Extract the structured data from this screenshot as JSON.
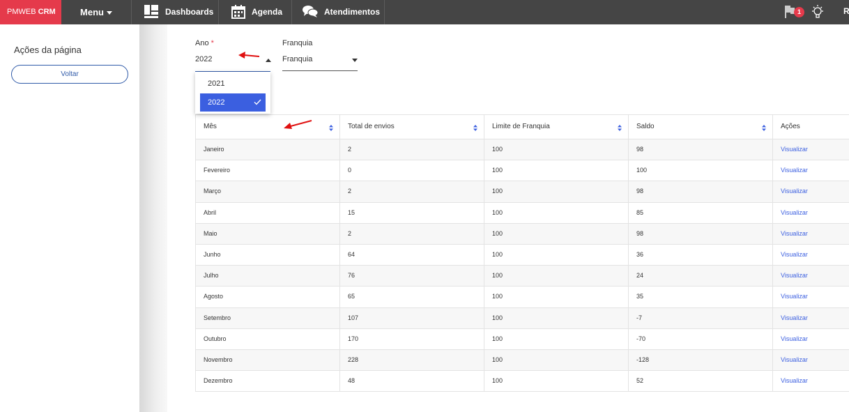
{
  "topbar": {
    "brand_light": "PMWEB ",
    "brand_bold": "CRM",
    "menu_label": "Menu",
    "nav": [
      {
        "label": "Dashboards",
        "icon": "dashboard-icon"
      },
      {
        "label": "Agenda",
        "icon": "calendar-icon"
      },
      {
        "label": "Atendimentos",
        "icon": "chat-icon"
      }
    ],
    "notifications_count": "1",
    "user_initial": "R",
    "brand_color": "#e53a4b",
    "bar_color": "#454545"
  },
  "sidebar": {
    "title": "Ações da página",
    "back_label": "Voltar"
  },
  "filters": {
    "ano_label": "Ano",
    "ano_required": "*",
    "ano_value": "2022",
    "ano_options": [
      "2021",
      "2022"
    ],
    "ano_selected": "2022",
    "franquia_label": "Franquia",
    "franquia_value": "Franquia"
  },
  "table": {
    "headers": [
      "Mês",
      "Total de envios",
      "Limite de Franquia",
      "Saldo",
      "Ações"
    ],
    "rows": [
      [
        "Janeiro",
        "2",
        "100",
        "98",
        "Visualizar"
      ],
      [
        "Fevereiro",
        "0",
        "100",
        "100",
        "Visualizar"
      ],
      [
        "Março",
        "2",
        "100",
        "98",
        "Visualizar"
      ],
      [
        "Abril",
        "15",
        "100",
        "85",
        "Visualizar"
      ],
      [
        "Maio",
        "2",
        "100",
        "98",
        "Visualizar"
      ],
      [
        "Junho",
        "64",
        "100",
        "36",
        "Visualizar"
      ],
      [
        "Julho",
        "76",
        "100",
        "24",
        "Visualizar"
      ],
      [
        "Agosto",
        "65",
        "100",
        "35",
        "Visualizar"
      ],
      [
        "Setembro",
        "107",
        "100",
        "-7",
        "Visualizar"
      ],
      [
        "Outubro",
        "170",
        "100",
        "-70",
        "Visualizar"
      ],
      [
        "Novembro",
        "228",
        "100",
        "-128",
        "Visualizar"
      ],
      [
        "Dezembro",
        "48",
        "100",
        "52",
        "Visualizar"
      ]
    ]
  },
  "accent_color": "#3b5fe0",
  "annotation_color": "#e01010"
}
